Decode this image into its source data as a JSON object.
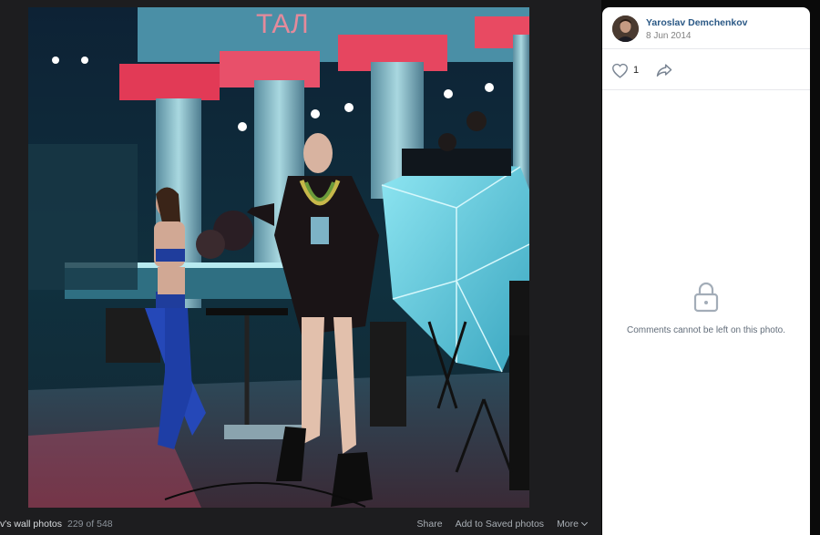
{
  "album": {
    "title": "v's wall photos",
    "counter": "229 of 548"
  },
  "photo_actions": {
    "share_label": "Share",
    "save_label": "Add to Saved photos",
    "more_label": "More"
  },
  "author": {
    "name": "Yaroslav Demchenkov",
    "date": "8 Jun 2014"
  },
  "reactions": {
    "like_count": "1"
  },
  "comments": {
    "closed_message": "Comments cannot be left on this photo."
  },
  "icons": {
    "like": "heart-icon",
    "share": "share-arrow-icon",
    "lock": "lock-icon",
    "more": "chevron-down-icon"
  },
  "colors": {
    "link": "#2a5885",
    "viewer_bg": "#1d1d1f",
    "secondary_text": "#828282"
  }
}
